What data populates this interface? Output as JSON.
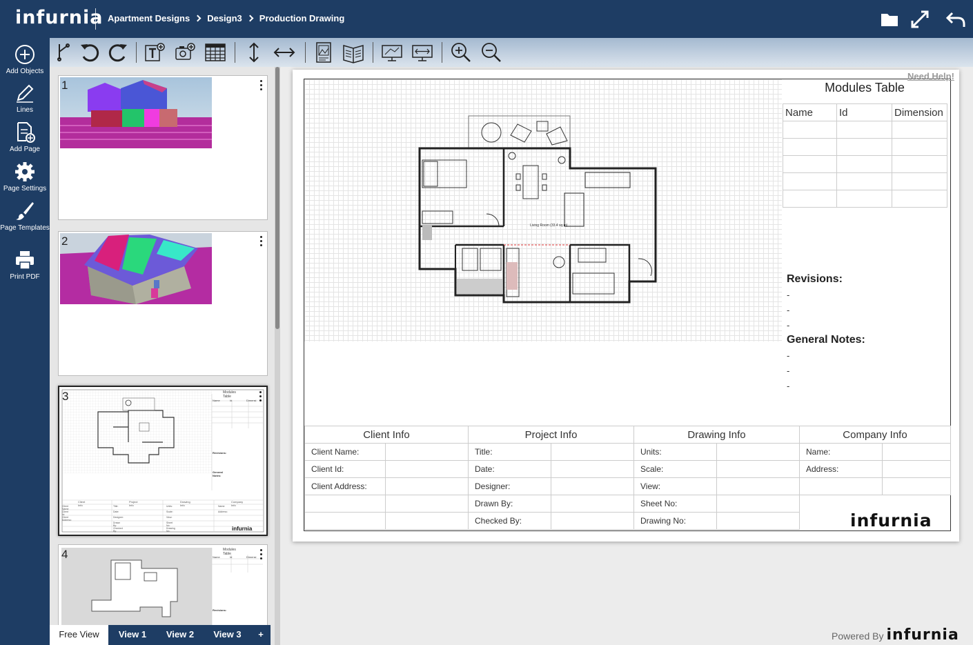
{
  "app": {
    "logo": "infurnia"
  },
  "breadcrumb": [
    "Apartment Designs",
    "Design3",
    "Production Drawing"
  ],
  "header_icons": [
    "folder-icon",
    "fullscreen-icon",
    "back-arrow-icon"
  ],
  "sidebar": {
    "items": [
      {
        "label": "Add Objects",
        "icon": "plus-circle-icon"
      },
      {
        "label": "Lines",
        "icon": "pencil-icon"
      },
      {
        "label": "Add Page",
        "icon": "add-page-icon"
      },
      {
        "label": "Page Settings",
        "icon": "gear-icon"
      },
      {
        "label": "Page Templates",
        "icon": "brush-icon"
      },
      {
        "label": "Print PDF",
        "icon": "printer-icon"
      }
    ]
  },
  "toolbar": {
    "tools": [
      "select-icon",
      "undo-icon",
      "redo-icon",
      "add-text-icon",
      "add-image-icon",
      "add-table-icon",
      "vertical-dimension-icon",
      "horizontal-dimension-icon",
      "page-portrait-icon",
      "page-landscape-icon",
      "fit-screen-icon",
      "fit-width-icon",
      "zoom-in-icon",
      "zoom-out-icon"
    ]
  },
  "pages": [
    {
      "number": "1"
    },
    {
      "number": "2"
    },
    {
      "number": "3",
      "mini": {
        "modules_title": "Modules Table",
        "cols": [
          "Name",
          "Id",
          "Dimensi"
        ],
        "revisions": "Revisions:",
        "notes": "General Notes:",
        "tb_headers": [
          "Client Info",
          "Project Info",
          "Drawing Info",
          "Company Info"
        ],
        "tb_rows": [
          [
            "Client Name:",
            "Title:",
            "Units:",
            "Name:"
          ],
          [
            "Client Id:",
            "Date:",
            "Scale:",
            "Address:"
          ],
          [
            "Client Address:",
            "Designer:",
            "View:",
            ""
          ],
          [
            "",
            "Drawn By:",
            "Sheet No:",
            ""
          ],
          [
            "",
            "Checked By:",
            "Drawing No:",
            ""
          ]
        ],
        "logo": "infurnia"
      }
    },
    {
      "number": "4",
      "mini": {
        "modules_title": "Modules Table",
        "cols": [
          "Name",
          "Id",
          "Dimensi"
        ],
        "revisions": "Revisions:"
      }
    }
  ],
  "view_tabs": [
    "Free View",
    "View 1",
    "View 2",
    "View 3",
    "+"
  ],
  "sheet": {
    "need_help": "Need Help!",
    "modules_table": {
      "title": "Modules Table",
      "columns": [
        "Name",
        "Id",
        "Dimension"
      ],
      "empty_rows": 5
    },
    "plan_labels": [
      "Living Room (33.4 sq.m)"
    ],
    "revisions": {
      "title": "Revisions:",
      "items": [
        "-",
        "-",
        "-"
      ]
    },
    "general_notes": {
      "title": "General Notes:",
      "items": [
        "-",
        "-",
        "-"
      ]
    },
    "title_block": {
      "headers": [
        "Client Info",
        "Project Info",
        "Drawing Info",
        "Company Info"
      ],
      "rows": [
        [
          "Client Name:",
          "Title:",
          "Units:",
          "Name:"
        ],
        [
          "Client Id:",
          "Date:",
          "Scale:",
          "Address:"
        ],
        [
          "Client Address:",
          "Designer:",
          "View:",
          ""
        ],
        [
          "",
          "Drawn By:",
          "Sheet No:",
          ""
        ],
        [
          "",
          "Checked By:",
          "Drawing No:",
          ""
        ]
      ],
      "logo": "infurnia"
    }
  },
  "footer": {
    "powered_by": "Powered By",
    "brand": "infurnia"
  }
}
